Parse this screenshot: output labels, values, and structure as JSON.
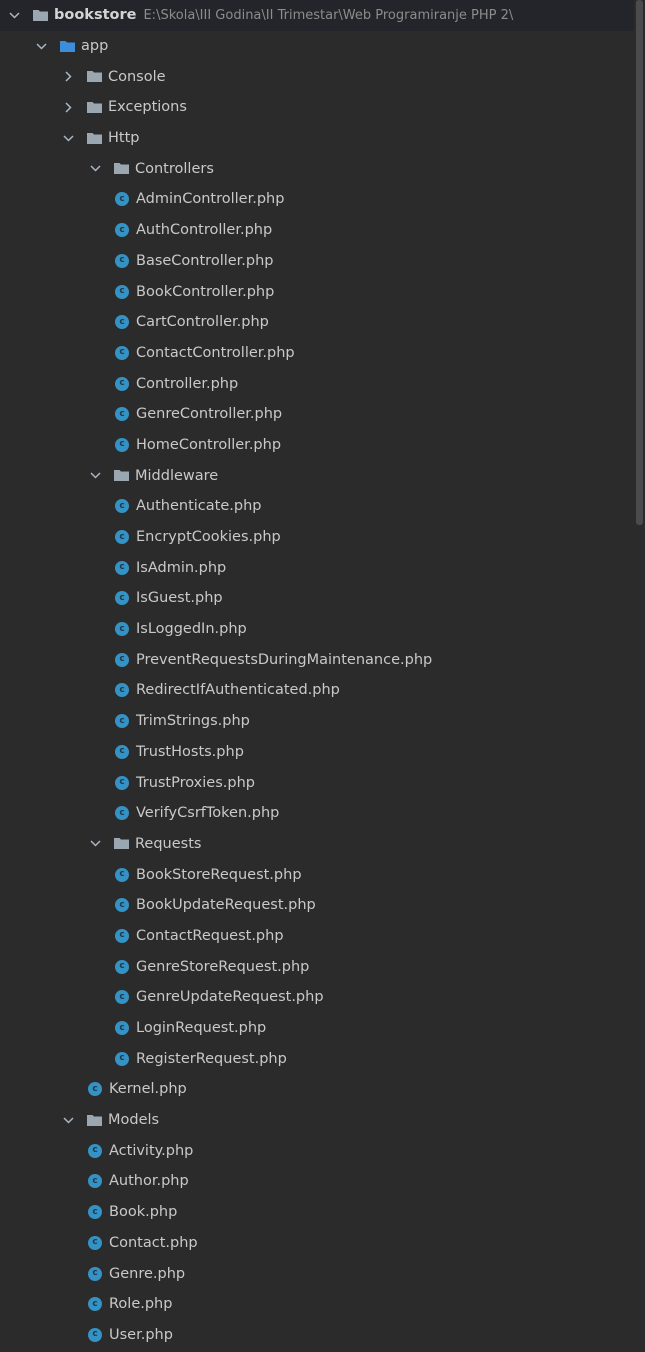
{
  "project": {
    "name": "bookstore",
    "path": "E:\\Skola\\III Godina\\II Trimestar\\Web Programiranje PHP 2\\"
  },
  "tree": [
    {
      "depth": 0,
      "type": "folder",
      "state": "expanded",
      "label": "bookstore",
      "bold": true,
      "path": "E:\\Skola\\III Godina\\II Trimestar\\Web Programiranje PHP 2\\",
      "icon": "folder-icon",
      "folder_color": "#9aa7b0"
    },
    {
      "depth": 1,
      "type": "folder",
      "state": "expanded",
      "label": "app",
      "icon": "source-folder-icon",
      "folder_color": "#3c8ddc"
    },
    {
      "depth": 2,
      "type": "folder",
      "state": "collapsed",
      "label": "Console",
      "icon": "folder-icon",
      "folder_color": "#9aa7b0"
    },
    {
      "depth": 2,
      "type": "folder",
      "state": "collapsed",
      "label": "Exceptions",
      "icon": "folder-icon",
      "folder_color": "#9aa7b0"
    },
    {
      "depth": 2,
      "type": "folder",
      "state": "expanded",
      "label": "Http",
      "icon": "folder-icon",
      "folder_color": "#9aa7b0"
    },
    {
      "depth": 3,
      "type": "folder",
      "state": "expanded",
      "label": "Controllers",
      "icon": "folder-icon",
      "folder_color": "#9aa7b0"
    },
    {
      "depth": 4,
      "type": "file",
      "label": "AdminController.php",
      "icon": "php-class-icon"
    },
    {
      "depth": 4,
      "type": "file",
      "label": "AuthController.php",
      "icon": "php-class-icon"
    },
    {
      "depth": 4,
      "type": "file",
      "label": "BaseController.php",
      "icon": "php-class-icon"
    },
    {
      "depth": 4,
      "type": "file",
      "label": "BookController.php",
      "icon": "php-class-icon"
    },
    {
      "depth": 4,
      "type": "file",
      "label": "CartController.php",
      "icon": "php-class-icon"
    },
    {
      "depth": 4,
      "type": "file",
      "label": "ContactController.php",
      "icon": "php-class-icon"
    },
    {
      "depth": 4,
      "type": "file",
      "label": "Controller.php",
      "icon": "php-class-icon"
    },
    {
      "depth": 4,
      "type": "file",
      "label": "GenreController.php",
      "icon": "php-class-icon"
    },
    {
      "depth": 4,
      "type": "file",
      "label": "HomeController.php",
      "icon": "php-class-icon"
    },
    {
      "depth": 3,
      "type": "folder",
      "state": "expanded",
      "label": "Middleware",
      "icon": "folder-icon",
      "folder_color": "#9aa7b0"
    },
    {
      "depth": 4,
      "type": "file",
      "label": "Authenticate.php",
      "icon": "php-class-icon"
    },
    {
      "depth": 4,
      "type": "file",
      "label": "EncryptCookies.php",
      "icon": "php-class-icon"
    },
    {
      "depth": 4,
      "type": "file",
      "label": "IsAdmin.php",
      "icon": "php-class-icon"
    },
    {
      "depth": 4,
      "type": "file",
      "label": "IsGuest.php",
      "icon": "php-class-icon"
    },
    {
      "depth": 4,
      "type": "file",
      "label": "IsLoggedIn.php",
      "icon": "php-class-icon"
    },
    {
      "depth": 4,
      "type": "file",
      "label": "PreventRequestsDuringMaintenance.php",
      "icon": "php-class-icon"
    },
    {
      "depth": 4,
      "type": "file",
      "label": "RedirectIfAuthenticated.php",
      "icon": "php-class-icon"
    },
    {
      "depth": 4,
      "type": "file",
      "label": "TrimStrings.php",
      "icon": "php-class-icon"
    },
    {
      "depth": 4,
      "type": "file",
      "label": "TrustHosts.php",
      "icon": "php-class-icon"
    },
    {
      "depth": 4,
      "type": "file",
      "label": "TrustProxies.php",
      "icon": "php-class-icon"
    },
    {
      "depth": 4,
      "type": "file",
      "label": "VerifyCsrfToken.php",
      "icon": "php-class-icon"
    },
    {
      "depth": 3,
      "type": "folder",
      "state": "expanded",
      "label": "Requests",
      "icon": "folder-icon",
      "folder_color": "#9aa7b0"
    },
    {
      "depth": 4,
      "type": "file",
      "label": "BookStoreRequest.php",
      "icon": "php-class-icon"
    },
    {
      "depth": 4,
      "type": "file",
      "label": "BookUpdateRequest.php",
      "icon": "php-class-icon"
    },
    {
      "depth": 4,
      "type": "file",
      "label": "ContactRequest.php",
      "icon": "php-class-icon"
    },
    {
      "depth": 4,
      "type": "file",
      "label": "GenreStoreRequest.php",
      "icon": "php-class-icon"
    },
    {
      "depth": 4,
      "type": "file",
      "label": "GenreUpdateRequest.php",
      "icon": "php-class-icon"
    },
    {
      "depth": 4,
      "type": "file",
      "label": "LoginRequest.php",
      "icon": "php-class-icon"
    },
    {
      "depth": 4,
      "type": "file",
      "label": "RegisterRequest.php",
      "icon": "php-class-icon"
    },
    {
      "depth": 3,
      "type": "file",
      "label": "Kernel.php",
      "icon": "php-class-icon"
    },
    {
      "depth": 2,
      "type": "folder",
      "state": "expanded",
      "label": "Models",
      "icon": "folder-icon",
      "folder_color": "#9aa7b0"
    },
    {
      "depth": 3,
      "type": "file",
      "label": "Activity.php",
      "icon": "php-class-icon"
    },
    {
      "depth": 3,
      "type": "file",
      "label": "Author.php",
      "icon": "php-class-icon"
    },
    {
      "depth": 3,
      "type": "file",
      "label": "Book.php",
      "icon": "php-class-icon"
    },
    {
      "depth": 3,
      "type": "file",
      "label": "Contact.php",
      "icon": "php-class-icon"
    },
    {
      "depth": 3,
      "type": "file",
      "label": "Genre.php",
      "icon": "php-class-icon"
    },
    {
      "depth": 3,
      "type": "file",
      "label": "Role.php",
      "icon": "php-class-icon"
    },
    {
      "depth": 3,
      "type": "file",
      "label": "User.php",
      "icon": "php-class-icon"
    }
  ],
  "colors": {
    "background": "#2b2b2b",
    "text": "#c9c9c9",
    "path_text": "#8c8c8c",
    "chevron": "#a9b7c6",
    "class_icon": "#3592c4",
    "folder_grey": "#9aa7b0",
    "folder_blue": "#3c8ddc",
    "scrollbar_thumb": "#4b4b4b"
  },
  "class_icon_letter": "c"
}
